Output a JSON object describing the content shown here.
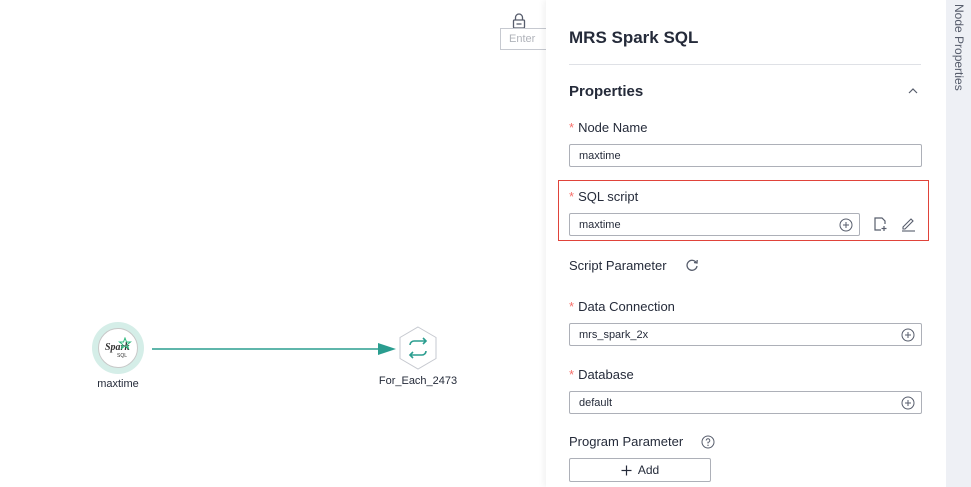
{
  "canvas": {
    "search_placeholder": "Enter",
    "nodes": [
      {
        "label": "maxtime",
        "type": "spark-sql",
        "logo_text": "Spark",
        "logo_sub": "SQL"
      },
      {
        "label": "For_Each_2473",
        "type": "for-each"
      }
    ],
    "edge_color": "#2a9d8f"
  },
  "panel": {
    "title": "MRS Spark SQL",
    "section_title": "Properties",
    "fields": {
      "node_name": {
        "label": "Node Name",
        "value": "maxtime",
        "required": "*"
      },
      "sql_script": {
        "label": "SQL script",
        "value": "maxtime",
        "required": "*"
      },
      "script_parameter": {
        "label": "Script Parameter"
      },
      "data_connection": {
        "label": "Data Connection",
        "value": "mrs_spark_2x",
        "required": "*"
      },
      "database": {
        "label": "Database",
        "value": "default",
        "required": "*"
      },
      "program_parameter": {
        "label": "Program Parameter"
      }
    },
    "add_button_label": "Add"
  },
  "rail": {
    "tab_label": "Node Properties"
  },
  "colors": {
    "required": "#f66f6a",
    "highlight": "#e0433a",
    "text": "#252b3a"
  },
  "icons": [
    "lock-icon",
    "chevron-up-icon",
    "plus-circle-icon",
    "new-file-icon",
    "edit-icon",
    "refresh-icon",
    "help-icon",
    "plus-icon",
    "loop-icon",
    "spark-logo"
  ]
}
